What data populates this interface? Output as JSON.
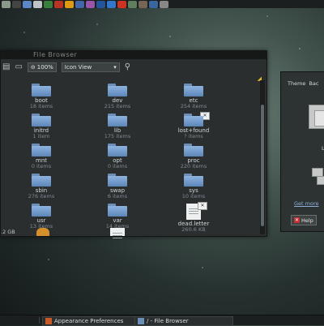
{
  "top_panel": {
    "launchers": [
      {
        "icon": "home-icon",
        "color": "#8a9a8a"
      },
      {
        "icon": "terminal-icon",
        "color": "#444444"
      },
      {
        "icon": "globe-icon",
        "color": "#5b87c7"
      },
      {
        "icon": "mail-icon",
        "color": "#c0c4c8"
      },
      {
        "icon": "chat-icon",
        "color": "#3a7f3a"
      },
      {
        "icon": "media-icon",
        "color": "#bb3322"
      },
      {
        "icon": "music-icon",
        "color": "#dd9911"
      },
      {
        "icon": "photo-icon",
        "color": "#4466aa"
      },
      {
        "icon": "image-icon",
        "color": "#9955aa"
      },
      {
        "icon": "video-icon",
        "color": "#225599"
      },
      {
        "icon": "office-icon",
        "color": "#3377cc"
      },
      {
        "icon": "editor-icon",
        "color": "#cc3322"
      },
      {
        "icon": "calc-icon",
        "color": "#5f7f5f"
      },
      {
        "icon": "settings-icon",
        "color": "#776655"
      },
      {
        "icon": "network-icon",
        "color": "#3a66a0"
      },
      {
        "icon": "clock-icon",
        "color": "#888888"
      }
    ]
  },
  "file_browser": {
    "title": "File Browser",
    "zoom": "100%",
    "view_mode": "Icon View",
    "status": ".2 GB",
    "items": [
      {
        "name": "boot",
        "count": "18 items",
        "type": "folder"
      },
      {
        "name": "dev",
        "count": "215 items",
        "type": "folder"
      },
      {
        "name": "etc",
        "count": "254 items",
        "type": "folder"
      },
      {
        "name": "initrd",
        "count": "1 item",
        "type": "folder"
      },
      {
        "name": "lib",
        "count": "175 items",
        "type": "folder"
      },
      {
        "name": "lost+found",
        "count": "? items",
        "type": "folder-locked"
      },
      {
        "name": "mnt",
        "count": "0 items",
        "type": "folder"
      },
      {
        "name": "opt",
        "count": "0 items",
        "type": "folder"
      },
      {
        "name": "proc",
        "count": "220 items",
        "type": "folder"
      },
      {
        "name": "sbin",
        "count": "276 items",
        "type": "folder"
      },
      {
        "name": "swap",
        "count": "6 items",
        "type": "folder"
      },
      {
        "name": "sys",
        "count": "10 items",
        "type": "folder"
      },
      {
        "name": "usr",
        "count": "13 items",
        "type": "folder"
      },
      {
        "name": "var",
        "count": "14 items",
        "type": "folder"
      },
      {
        "name": "dead.letter",
        "count": "260.6 KB",
        "type": "document-locked"
      }
    ]
  },
  "appearance": {
    "tabs": [
      "Theme",
      "Bac"
    ],
    "label": "L",
    "link": "Get more",
    "help_label": "Help"
  },
  "taskbar": {
    "tasks": [
      {
        "label": "Appearance Preferences",
        "icon_color": "#c85a2a"
      },
      {
        "label": "/ - File Browser",
        "icon_color": "#6d8fb7"
      }
    ]
  }
}
